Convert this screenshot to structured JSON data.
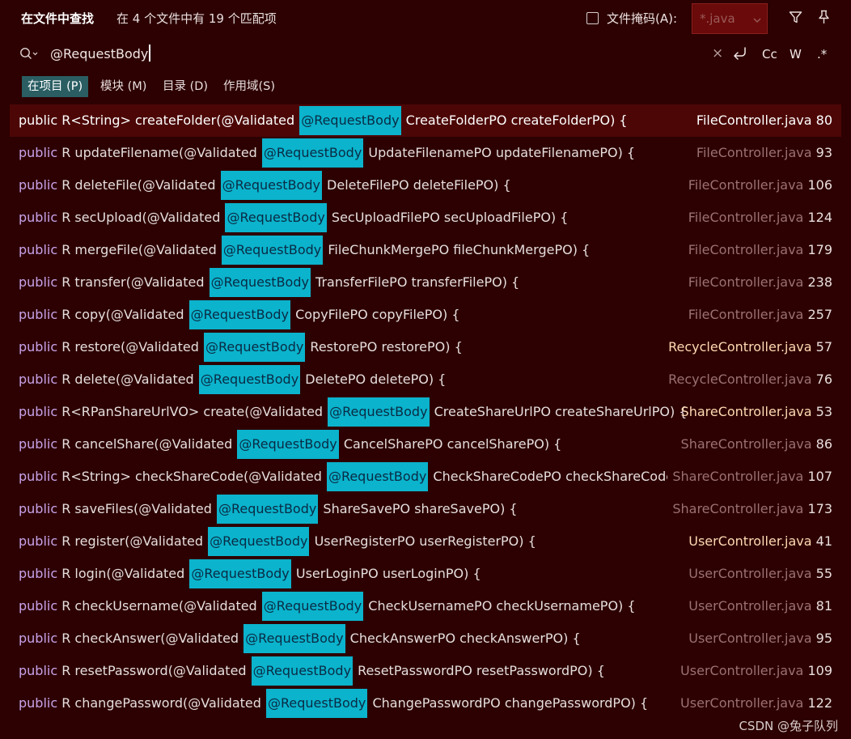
{
  "header": {
    "title": "在文件中查找",
    "summary": "在 4 个文件中有 19 个匹配项",
    "file_mask_label": "文件掩码(A):",
    "file_mask_value": "*.java"
  },
  "search": {
    "query": "@RequestBody",
    "tools": {
      "clear": "×",
      "match_case": "Cc",
      "words": "W",
      "regex": ".*"
    }
  },
  "scopes": [
    {
      "label": "在项目 (P)",
      "active": true
    },
    {
      "label": "模块 (M)",
      "active": false
    },
    {
      "label": "目录 (D)",
      "active": false
    },
    {
      "label": "作用域(S)",
      "active": false
    }
  ],
  "results": [
    {
      "before_kw": "public",
      "before": " R<String> createFolder(@Validated ",
      "match": "@RequestBody",
      "after": " CreateFolderPO createFolderPO) {",
      "file": "FileController.java",
      "line": "80",
      "selected": true,
      "file_style": "bright"
    },
    {
      "before_kw": "public",
      "before": " R updateFilename(@Validated ",
      "match": "@RequestBody",
      "after": " UpdateFilenamePO updateFilenamePO) {",
      "file": "FileController.java",
      "line": "93",
      "file_style": "dim"
    },
    {
      "before_kw": "public",
      "before": " R deleteFile(@Validated ",
      "match": "@RequestBody",
      "after": " DeleteFilePO deleteFilePO) {",
      "file": "FileController.java",
      "line": "106",
      "file_style": "dim"
    },
    {
      "before_kw": "public",
      "before": " R secUpload(@Validated ",
      "match": "@RequestBody",
      "after": " SecUploadFilePO secUploadFilePO) {",
      "file": "FileController.java",
      "line": "124",
      "file_style": "dim"
    },
    {
      "before_kw": "public",
      "before": " R mergeFile(@Validated ",
      "match": "@RequestBody",
      "after": " FileChunkMergePO fileChunkMergePO) {",
      "file": "FileController.java",
      "line": "179",
      "file_style": "dim"
    },
    {
      "before_kw": "public",
      "before": " R transfer(@Validated ",
      "match": "@RequestBody",
      "after": " TransferFilePO transferFilePO) {",
      "file": "FileController.java",
      "line": "238",
      "file_style": "dim"
    },
    {
      "before_kw": "public",
      "before": " R copy(@Validated ",
      "match": "@RequestBody",
      "after": " CopyFilePO copyFilePO) {",
      "file": "FileController.java",
      "line": "257",
      "file_style": "dim"
    },
    {
      "before_kw": "public",
      "before": " R restore(@Validated ",
      "match": "@RequestBody",
      "after": " RestorePO restorePO) {",
      "file": "RecycleController.java",
      "line": "57",
      "file_style": "bright"
    },
    {
      "before_kw": "public",
      "before": " R delete(@Validated ",
      "match": "@RequestBody",
      "after": " DeletePO deletePO) {",
      "file": "RecycleController.java",
      "line": "76",
      "file_style": "dim"
    },
    {
      "before_kw": "public",
      "before": " R<RPanShareUrlVO> create(@Validated ",
      "match": "@RequestBody",
      "after": " CreateShareUrlPO createShareUrlPO) {",
      "file": "ShareController.java",
      "line": "53",
      "file_style": "bright"
    },
    {
      "before_kw": "public",
      "before": " R cancelShare(@Validated ",
      "match": "@RequestBody",
      "after": " CancelSharePO cancelSharePO) {",
      "file": "ShareController.java",
      "line": "86",
      "file_style": "dim"
    },
    {
      "before_kw": "public",
      "before": " R<String> checkShareCode(@Validated ",
      "match": "@RequestBody",
      "after": " CheckShareCodePO checkShareCodePO) ·",
      "file": "ShareController.java",
      "line": "107",
      "file_style": "dim",
      "truncated": true
    },
    {
      "before_kw": "public",
      "before": " R saveFiles(@Validated ",
      "match": "@RequestBody",
      "after": " ShareSavePO shareSavePO) {",
      "file": "ShareController.java",
      "line": "173",
      "file_style": "dim"
    },
    {
      "before_kw": "public",
      "before": " R register(@Validated ",
      "match": "@RequestBody",
      "after": " UserRegisterPO userRegisterPO) {",
      "file": "UserController.java",
      "line": "41",
      "file_style": "bright"
    },
    {
      "before_kw": "public",
      "before": " R login(@Validated ",
      "match": "@RequestBody",
      "after": " UserLoginPO userLoginPO) {",
      "file": "UserController.java",
      "line": "55",
      "file_style": "dim"
    },
    {
      "before_kw": "public",
      "before": " R checkUsername(@Validated ",
      "match": "@RequestBody",
      "after": " CheckUsernamePO checkUsernamePO) {",
      "file": "UserController.java",
      "line": "81",
      "file_style": "dim"
    },
    {
      "before_kw": "public",
      "before": " R checkAnswer(@Validated ",
      "match": "@RequestBody",
      "after": " CheckAnswerPO checkAnswerPO) {",
      "file": "UserController.java",
      "line": "95",
      "file_style": "dim"
    },
    {
      "before_kw": "public",
      "before": " R resetPassword(@Validated ",
      "match": "@RequestBody",
      "after": " ResetPasswordPO resetPasswordPO) {",
      "file": "UserController.java",
      "line": "109",
      "file_style": "dim"
    },
    {
      "before_kw": "public",
      "before": " R changePassword(@Validated ",
      "match": "@RequestBody",
      "after": " ChangePasswordPO changePasswordPO) {",
      "file": "UserController.java",
      "line": "122",
      "file_style": "dim"
    }
  ],
  "watermark": "CSDN @兔子队列",
  "colors": {
    "background": "#2d0101",
    "selected_row": "#4c0606",
    "match_highlight": "#0bb3cc",
    "keyword": "#c7a3e9",
    "active_scope": "#2a5e63"
  }
}
